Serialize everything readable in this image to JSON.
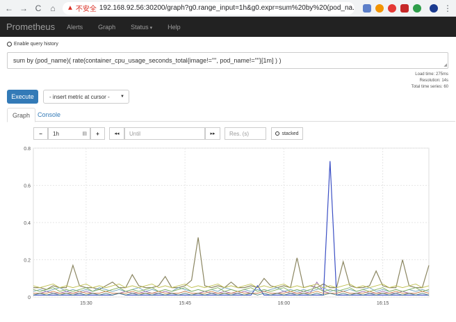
{
  "browser": {
    "back": "←",
    "forward": "→",
    "reload": "C",
    "home": "⌂",
    "warning": "▲",
    "insecure_label": "不安全",
    "url": "192.168.92.56:30200/graph?g0.range_input=1h&g0.expr=sum%20by%20(pod_na..."
  },
  "navbar": {
    "brand": "Prometheus",
    "links": [
      "Alerts",
      "Graph",
      "Status",
      "Help"
    ]
  },
  "query": {
    "enable_history": "Enable query history",
    "expression": "sum by (pod_name)( rate(container_cpu_usage_seconds_total{image!=\"\", pod_name!=\"\"}[1m] ) )",
    "resize_grip": "◢"
  },
  "stats": {
    "load_time": "Load time: 275ms",
    "resolution": "Resolution: 14s",
    "total_series": "Total time series: 60"
  },
  "actions": {
    "execute": "Execute",
    "insert_metric": "- insert metric at cursor -",
    "insert_caret": "▼"
  },
  "tabs": {
    "graph": "Graph",
    "console": "Console"
  },
  "controls": {
    "minus": "−",
    "range": "1h",
    "range_icon": "▤",
    "plus": "+",
    "back": "◂◂",
    "until": "Until",
    "forward": "▸▸",
    "res_placeholder": "Res. (s)",
    "stacked": "stacked"
  },
  "colors": {
    "navbar_bg": "#222222",
    "execute": "#337ab7",
    "link": "#337ab7",
    "series_main": "#8b8661",
    "series_spike": "#3b4fc4"
  },
  "chart_data": {
    "type": "line",
    "title": "",
    "xlabel": "",
    "ylabel": "",
    "ylim": [
      0,
      0.8
    ],
    "xlim_minutes_since_15_22": [
      0,
      60
    ],
    "yticks": [
      "0",
      "0.2",
      "0.4",
      "0.6",
      "0.8"
    ],
    "xticks": [
      {
        "label": "15:30",
        "minute": 8
      },
      {
        "label": "15:45",
        "minute": 23
      },
      {
        "label": "16:00",
        "minute": 38
      },
      {
        "label": "16:15",
        "minute": 53
      }
    ],
    "series": [
      {
        "color": "#8b8661",
        "values": [
          0.05,
          0.05,
          0.04,
          0.06,
          0.05,
          0.05,
          0.17,
          0.06,
          0.05,
          0.05,
          0.04,
          0.06,
          0.08,
          0.05,
          0.05,
          0.12,
          0.06,
          0.05,
          0.05,
          0.06,
          0.11,
          0.05,
          0.05,
          0.06,
          0.09,
          0.32,
          0.06,
          0.05,
          0.06,
          0.05,
          0.08,
          0.05,
          0.05,
          0.06,
          0.05,
          0.1,
          0.06,
          0.05,
          0.06,
          0.05,
          0.21,
          0.05,
          0.06,
          0.05,
          0.07,
          0.05,
          0.05,
          0.19,
          0.06,
          0.05,
          0.05,
          0.06,
          0.14,
          0.06,
          0.05,
          0.05,
          0.2,
          0.06,
          0.05,
          0.05,
          0.17
        ]
      },
      {
        "color": "#3b4fc4",
        "values": [
          0.01,
          0.01,
          0.01,
          0.01,
          0.01,
          0.01,
          0.01,
          0.01,
          0.01,
          0.01,
          0.01,
          0.01,
          0.01,
          0.02,
          0.01,
          0.01,
          0.01,
          0.01,
          0.01,
          0.01,
          0.01,
          0.01,
          0.01,
          0.01,
          0.01,
          0.01,
          0.01,
          0.01,
          0.01,
          0.01,
          0.01,
          0.01,
          0.01,
          0.01,
          0.06,
          0.01,
          0.01,
          0.01,
          0.01,
          0.01,
          0.01,
          0.01,
          0.01,
          0.01,
          0.01,
          0.73,
          0.01,
          0.01,
          0.01,
          0.01,
          0.01,
          0.01,
          0.01,
          0.01,
          0.01,
          0.01,
          0.01,
          0.01,
          0.01,
          0.01,
          0.01
        ]
      },
      {
        "color": "#6aa0b8",
        "values": [
          0.03,
          0.04,
          0.03,
          0.04,
          0.05,
          0.03,
          0.04,
          0.03,
          0.04,
          0.03,
          0.05,
          0.04,
          0.03,
          0.04,
          0.03,
          0.04,
          0.05,
          0.03,
          0.04,
          0.03,
          0.04,
          0.03,
          0.05,
          0.04,
          0.03,
          0.04,
          0.03,
          0.04,
          0.03,
          0.05,
          0.04,
          0.03,
          0.04,
          0.03,
          0.04,
          0.03,
          0.04,
          0.05,
          0.03,
          0.04,
          0.03,
          0.04,
          0.03,
          0.04,
          0.05,
          0.03,
          0.04,
          0.03,
          0.04,
          0.03,
          0.04,
          0.05,
          0.03,
          0.04,
          0.03,
          0.04,
          0.03,
          0.04,
          0.03,
          0.04,
          0.03
        ]
      },
      {
        "color": "#9b6bb0",
        "values": [
          0.02,
          0.02,
          0.03,
          0.02,
          0.02,
          0.03,
          0.02,
          0.02,
          0.03,
          0.02,
          0.02,
          0.03,
          0.02,
          0.02,
          0.03,
          0.02,
          0.02,
          0.03,
          0.02,
          0.02,
          0.03,
          0.02,
          0.02,
          0.03,
          0.02,
          0.02,
          0.03,
          0.02,
          0.02,
          0.03,
          0.02,
          0.02,
          0.03,
          0.02,
          0.02,
          0.03,
          0.02,
          0.02,
          0.03,
          0.02,
          0.02,
          0.03,
          0.02,
          0.08,
          0.03,
          0.02,
          0.02,
          0.03,
          0.02,
          0.02,
          0.03,
          0.02,
          0.02,
          0.03,
          0.02,
          0.02,
          0.03,
          0.02,
          0.02,
          0.03,
          0.02
        ]
      },
      {
        "color": "#7fae5a",
        "values": [
          0.04,
          0.03,
          0.04,
          0.05,
          0.03,
          0.04,
          0.03,
          0.04,
          0.05,
          0.03,
          0.04,
          0.03,
          0.04,
          0.05,
          0.03,
          0.04,
          0.03,
          0.04,
          0.05,
          0.03,
          0.04,
          0.03,
          0.04,
          0.05,
          0.03,
          0.04,
          0.03,
          0.04,
          0.05,
          0.03,
          0.04,
          0.03,
          0.04,
          0.05,
          0.03,
          0.04,
          0.03,
          0.04,
          0.05,
          0.03,
          0.04,
          0.03,
          0.04,
          0.05,
          0.03,
          0.04,
          0.03,
          0.04,
          0.05,
          0.03,
          0.04,
          0.03,
          0.04,
          0.05,
          0.03,
          0.04,
          0.03,
          0.04,
          0.05,
          0.03,
          0.04
        ]
      },
      {
        "color": "#d08a4a",
        "values": [
          0.02,
          0.02,
          0.02,
          0.03,
          0.02,
          0.02,
          0.02,
          0.03,
          0.02,
          0.02,
          0.02,
          0.03,
          0.02,
          0.02,
          0.02,
          0.03,
          0.02,
          0.02,
          0.02,
          0.03,
          0.02,
          0.02,
          0.02,
          0.03,
          0.02,
          0.02,
          0.02,
          0.03,
          0.02,
          0.02,
          0.02,
          0.03,
          0.02,
          0.02,
          0.02,
          0.03,
          0.02,
          0.02,
          0.02,
          0.03,
          0.02,
          0.02,
          0.02,
          0.03,
          0.02,
          0.02,
          0.02,
          0.03,
          0.02,
          0.02,
          0.02,
          0.03,
          0.02,
          0.02,
          0.02,
          0.03,
          0.02,
          0.02,
          0.02,
          0.03,
          0.02
        ]
      },
      {
        "color": "#4a7f7a",
        "values": [
          0.01,
          0.02,
          0.01,
          0.02,
          0.01,
          0.02,
          0.01,
          0.02,
          0.01,
          0.02,
          0.01,
          0.02,
          0.01,
          0.02,
          0.01,
          0.02,
          0.01,
          0.02,
          0.01,
          0.02,
          0.01,
          0.02,
          0.01,
          0.02,
          0.01,
          0.02,
          0.01,
          0.02,
          0.01,
          0.02,
          0.01,
          0.02,
          0.01,
          0.02,
          0.01,
          0.02,
          0.01,
          0.02,
          0.01,
          0.02,
          0.01,
          0.02,
          0.01,
          0.02,
          0.01,
          0.02,
          0.01,
          0.02,
          0.01,
          0.02,
          0.01,
          0.02,
          0.01,
          0.02,
          0.01,
          0.02,
          0.01,
          0.02,
          0.01,
          0.02,
          0.01
        ]
      },
      {
        "color": "#c0c050",
        "values": [
          0.06,
          0.05,
          0.06,
          0.07,
          0.05,
          0.06,
          0.05,
          0.06,
          0.07,
          0.05,
          0.06,
          0.05,
          0.06,
          0.07,
          0.05,
          0.06,
          0.05,
          0.06,
          0.07,
          0.05,
          0.06,
          0.05,
          0.06,
          0.07,
          0.05,
          0.06,
          0.05,
          0.06,
          0.07,
          0.05,
          0.06,
          0.05,
          0.06,
          0.07,
          0.05,
          0.06,
          0.05,
          0.06,
          0.07,
          0.05,
          0.06,
          0.05,
          0.06,
          0.07,
          0.05,
          0.06,
          0.05,
          0.06,
          0.07,
          0.05,
          0.06,
          0.05,
          0.06,
          0.07,
          0.05,
          0.06,
          0.05,
          0.06,
          0.07,
          0.05,
          0.06
        ]
      }
    ]
  }
}
